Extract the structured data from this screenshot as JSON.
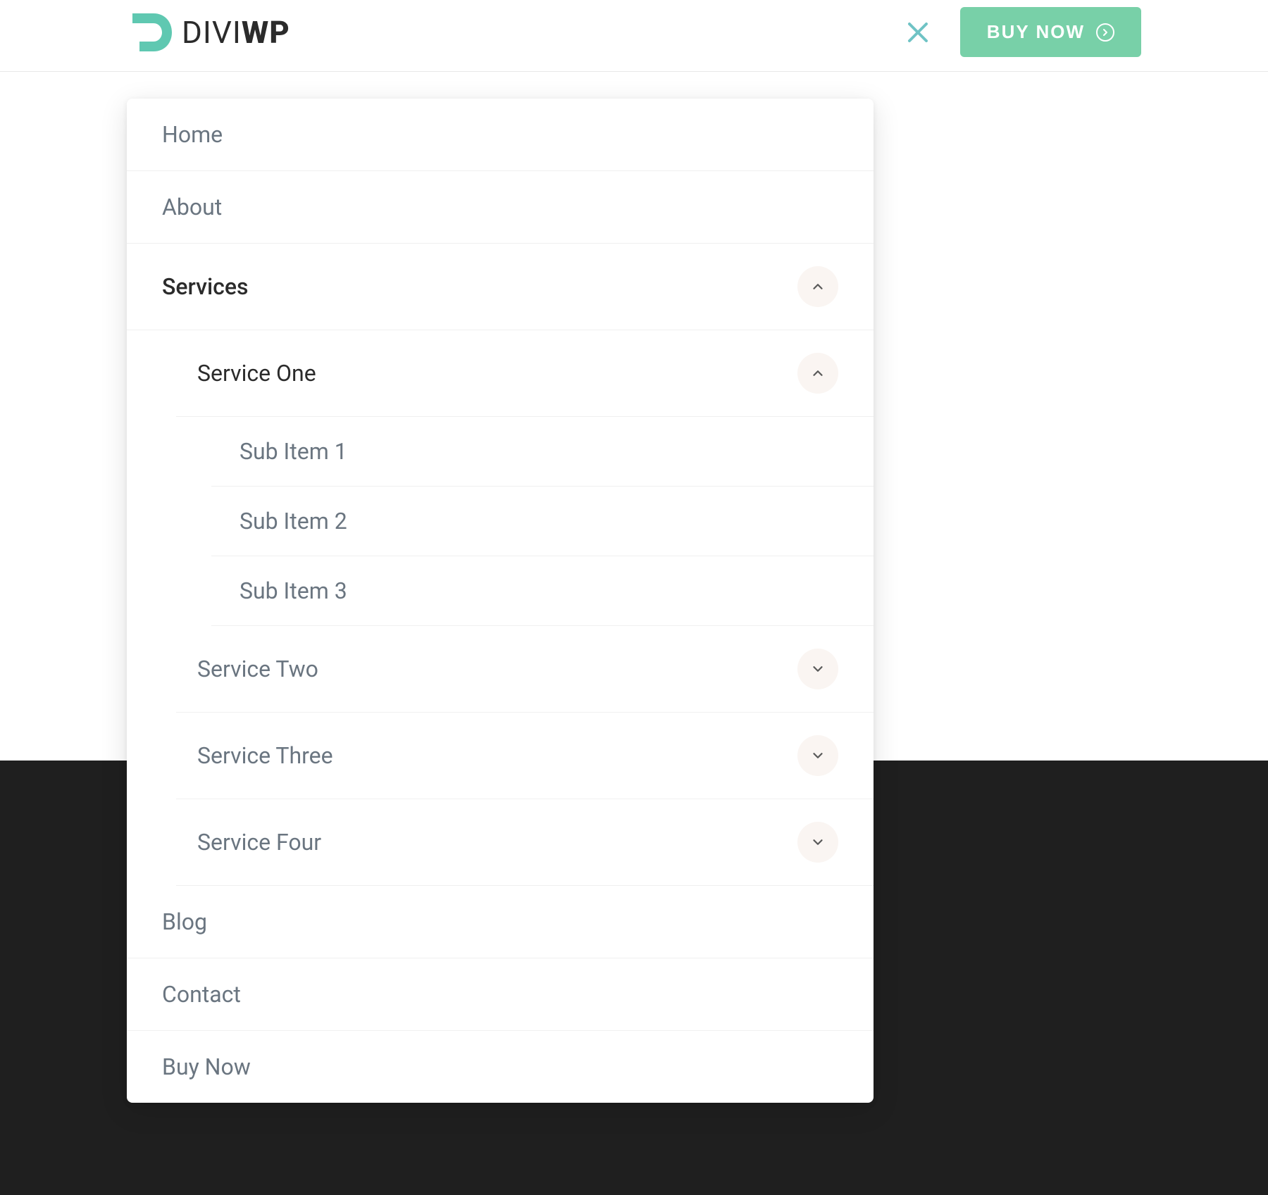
{
  "header": {
    "logo": {
      "text_part1": "DIVI",
      "text_part2": "WP"
    },
    "buy_now_label": "BUY NOW"
  },
  "menu": {
    "items": [
      {
        "label": "Home"
      },
      {
        "label": "About"
      },
      {
        "label": "Services",
        "expanded": true
      },
      {
        "label": "Blog"
      },
      {
        "label": "Contact"
      },
      {
        "label": "Buy Now"
      }
    ],
    "services_submenu": [
      {
        "label": "Service One",
        "expanded": true
      },
      {
        "label": "Service Two",
        "expanded": false
      },
      {
        "label": "Service Three",
        "expanded": false
      },
      {
        "label": "Service Four",
        "expanded": false
      }
    ],
    "service_one_submenu": [
      {
        "label": "Sub Item 1"
      },
      {
        "label": "Sub Item 2"
      },
      {
        "label": "Sub Item 3"
      }
    ]
  }
}
